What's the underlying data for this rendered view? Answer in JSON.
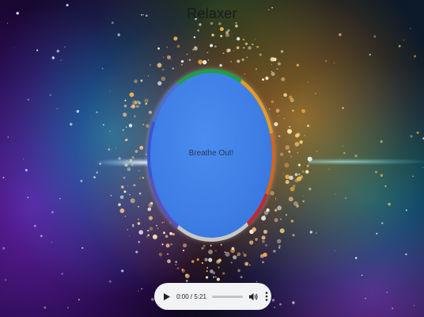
{
  "app": {
    "title": "Relaxer"
  },
  "breathing": {
    "instruction": "Breathe Out!"
  },
  "audio_player": {
    "time_display": "0:00 / 5:21",
    "progress": 0
  },
  "icons": {
    "play": "play-icon",
    "volume": "volume-icon",
    "more": "more-vertical-icon"
  },
  "colors": {
    "ball": "#3f7fe6",
    "ring_green": "#1f9e4a",
    "ring_orange": "#e39c27",
    "ring_red": "#c4272f",
    "ring_gray": "#c8c8c8",
    "ring_blue": "#3b55d4",
    "player_bg": "#f1f3f4"
  }
}
